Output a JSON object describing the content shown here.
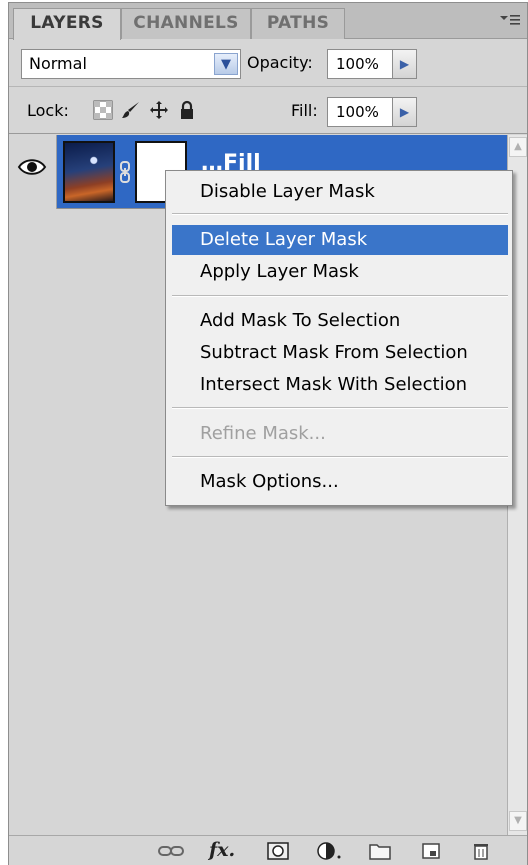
{
  "tabs": [
    {
      "label": "LAYERS",
      "active": true
    },
    {
      "label": "CHANNELS",
      "active": false
    },
    {
      "label": "PATHS",
      "active": false
    }
  ],
  "panel_menu_icon": "panel-menu-icon",
  "blend_mode": {
    "value": "Normal"
  },
  "opacity": {
    "label": "Opacity:",
    "value": "100%"
  },
  "lock": {
    "label": "Lock:",
    "icons": [
      "lock-transparent-pixels-icon",
      "lock-image-pixels-icon",
      "lock-position-icon",
      "lock-all-icon"
    ]
  },
  "fill": {
    "label": "Fill:",
    "value": "100%"
  },
  "layer": {
    "name": "…Fill",
    "selected": true
  },
  "context_menu": {
    "items": [
      {
        "label": "Disable Layer Mask",
        "state": "normal"
      },
      {
        "label": "Delete Layer Mask",
        "state": "highlighted"
      },
      {
        "label": "Apply Layer Mask",
        "state": "normal"
      },
      {
        "label": "Add Mask To Selection",
        "state": "normal"
      },
      {
        "label": "Subtract Mask From Selection",
        "state": "normal"
      },
      {
        "label": "Intersect Mask With Selection",
        "state": "normal"
      },
      {
        "label": "Refine Mask...",
        "state": "disabled"
      },
      {
        "label": "Mask Options...",
        "state": "normal"
      }
    ]
  },
  "bottom_toolbar": {
    "icons": [
      "link-layers-icon",
      "layer-style-fx-icon",
      "add-mask-icon",
      "adjustment-layer-icon",
      "new-group-icon",
      "new-layer-icon",
      "trash-icon"
    ]
  },
  "colors": {
    "selection": "#2f68c4",
    "menu_highlight": "#3a75c9",
    "panel_bg": "#d6d6d6"
  }
}
